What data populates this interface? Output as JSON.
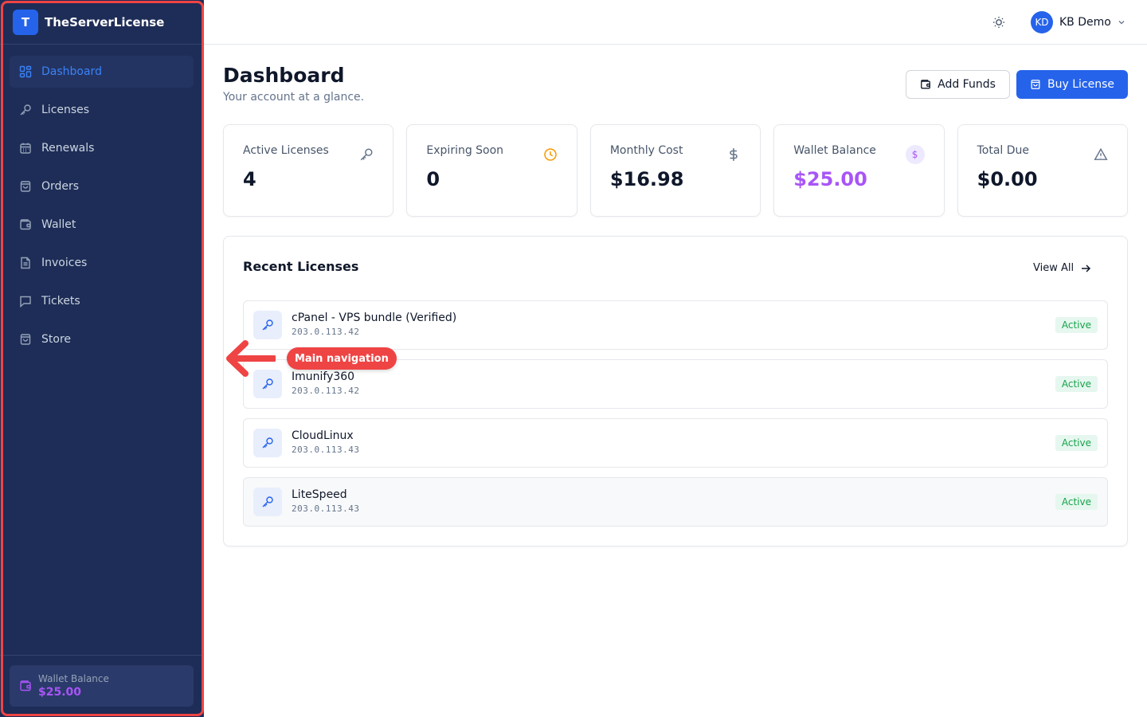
{
  "brand": {
    "logo_letter": "T",
    "name": "TheServerLicense"
  },
  "sidebar": {
    "items": [
      {
        "label": "Dashboard",
        "icon": "dashboard-grid-icon",
        "active": true
      },
      {
        "label": "Licenses",
        "icon": "key-icon"
      },
      {
        "label": "Renewals",
        "icon": "calendar-icon"
      },
      {
        "label": "Orders",
        "icon": "bag-icon"
      },
      {
        "label": "Wallet",
        "icon": "wallet-icon"
      },
      {
        "label": "Invoices",
        "icon": "file-icon"
      },
      {
        "label": "Tickets",
        "icon": "message-icon"
      },
      {
        "label": "Store",
        "icon": "store-icon"
      }
    ],
    "wallet": {
      "label": "Wallet Balance",
      "value": "$25.00"
    }
  },
  "topbar": {
    "user_initials": "KD",
    "user_name": "KB Demo"
  },
  "page": {
    "title": "Dashboard",
    "subtitle": "Your account at a glance.",
    "add_funds_label": "Add Funds",
    "buy_license_label": "Buy License"
  },
  "stats": [
    {
      "label": "Active Licenses",
      "value": "4",
      "icon": "key-icon"
    },
    {
      "label": "Expiring Soon",
      "value": "0",
      "icon": "clock-icon"
    },
    {
      "label": "Monthly Cost",
      "value": "$16.98",
      "icon": "dollar-icon"
    },
    {
      "label": "Wallet Balance",
      "value": "$25.00",
      "icon": "dollar-circle-icon",
      "icon_glyph": "$"
    },
    {
      "label": "Total Due",
      "value": "$0.00",
      "icon": "warning-icon"
    }
  ],
  "recent": {
    "title": "Recent Licenses",
    "view_all": "View All",
    "items": [
      {
        "name": "cPanel - VPS bundle (Verified)",
        "ip": "203.0.113.42",
        "status": "Active"
      },
      {
        "name": "Imunify360",
        "ip": "203.0.113.42",
        "status": "Active"
      },
      {
        "name": "CloudLinux",
        "ip": "203.0.113.43",
        "status": "Active"
      },
      {
        "name": "LiteSpeed",
        "ip": "203.0.113.43",
        "status": "Active"
      }
    ]
  },
  "annotation": {
    "label": "Main navigation"
  },
  "colors": {
    "sidebar_bg": "#1e2d57",
    "accent": "#2563eb",
    "wallet_purple": "#a855f7",
    "status_green": "#16a34a",
    "annotation_red": "#ef4444"
  }
}
